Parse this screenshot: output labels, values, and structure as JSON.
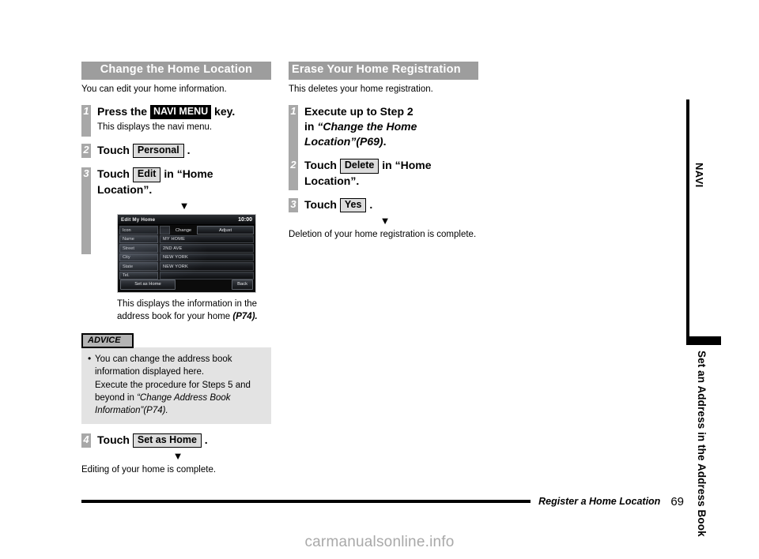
{
  "left_section": {
    "header": "Change the Home Location",
    "intro": "You can edit your home information.",
    "steps": [
      {
        "number": "1",
        "title_before": "Press the",
        "chip": "NAVI MENU",
        "title_after": "key.",
        "sub": "This displays the navi menu."
      },
      {
        "number": "2",
        "title_before": "Touch",
        "chip": "Personal",
        "title_after": "."
      },
      {
        "number": "3",
        "title_before": "Touch",
        "chip": "Edit",
        "title_after": "in “Home",
        "title_line2": "Location”."
      },
      {
        "number": "4",
        "title_before": "Touch",
        "chip": "Set as Home",
        "title_after": "."
      }
    ],
    "arrow": "▼",
    "nav_screen": {
      "title": "Edit My Home",
      "clock": "10:00",
      "icon_label": "Icon",
      "change_label": "Change",
      "adjust_label": "Adjust",
      "rows": [
        {
          "label": "Name",
          "value": "MY HOME"
        },
        {
          "label": "Street",
          "value": "2ND AVE"
        },
        {
          "label": "City",
          "value": "NEW YORK"
        },
        {
          "label": "State",
          "value": "NEW YORK"
        },
        {
          "label": "Tel.",
          "value": ""
        }
      ],
      "set_as_home": "Set as Home",
      "back": "Back"
    },
    "nav_caption": "This displays the information in the address book for your home",
    "nav_caption_ref": "(P74).",
    "advice": {
      "label": "ADVICE",
      "line1": "You can change the address book information displayed here.",
      "line2": "Execute the procedure for Steps 5 and beyond in",
      "line2_italic": "“Change Address Book Information”(P74)."
    },
    "closing": "Editing of your home is complete."
  },
  "right_section": {
    "header": "Erase Your Home Registration",
    "intro": "This deletes your home registration.",
    "steps": [
      {
        "number": "1",
        "title_line1": "Execute up to Step 2",
        "title_line2_before": "in",
        "title_line2_italic": "“Change the Home",
        "title_line3_italic": "Location”(P69)",
        "title_line3_after": "."
      },
      {
        "number": "2",
        "title_before": "Touch",
        "chip": "Delete",
        "title_after": "in “Home",
        "title_line2": "Location”."
      },
      {
        "number": "3",
        "title_before": "Touch",
        "chip": "Yes",
        "title_after": "."
      }
    ],
    "arrow": "▼",
    "closing": "Deletion of your home registration is complete."
  },
  "side_tab": {
    "navi_label": "NAVI",
    "chapter_label": "Set an Address in the Address Book"
  },
  "footer": {
    "title": "Register a Home Location",
    "page": "69"
  },
  "watermark": "carmanualsonline.info"
}
